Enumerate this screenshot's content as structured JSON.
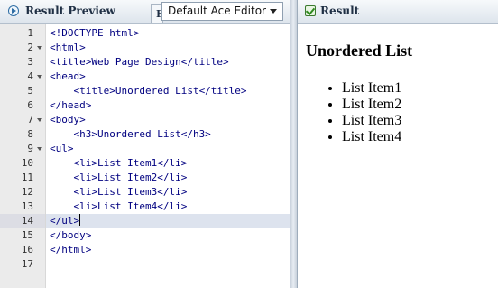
{
  "left_panel": {
    "title": "Result Preview",
    "tab_label": "E",
    "editor_select": {
      "selected": "Default Ace Editor"
    }
  },
  "editor": {
    "active_line": 14,
    "lines": [
      {
        "num": "1",
        "fold": false,
        "text": "<!DOCTYPE html>"
      },
      {
        "num": "2",
        "fold": true,
        "text": "<html>"
      },
      {
        "num": "3",
        "fold": false,
        "text": "<title>Web Page Design</title>"
      },
      {
        "num": "4",
        "fold": true,
        "text": "<head>"
      },
      {
        "num": "5",
        "fold": false,
        "text": "    <title>Unordered List</title>"
      },
      {
        "num": "6",
        "fold": false,
        "text": "</head>"
      },
      {
        "num": "7",
        "fold": true,
        "text": "<body>"
      },
      {
        "num": "8",
        "fold": false,
        "text": "    <h3>Unordered List</h3>"
      },
      {
        "num": "9",
        "fold": true,
        "text": "<ul>"
      },
      {
        "num": "10",
        "fold": false,
        "text": "    <li>List Item1</li>"
      },
      {
        "num": "11",
        "fold": false,
        "text": "    <li>List Item2</li>"
      },
      {
        "num": "12",
        "fold": false,
        "text": "    <li>List Item3</li>"
      },
      {
        "num": "13",
        "fold": false,
        "text": "    <li>List Item4</li>"
      },
      {
        "num": "14",
        "fold": false,
        "text": "</ul>"
      },
      {
        "num": "15",
        "fold": false,
        "text": "</body>"
      },
      {
        "num": "16",
        "fold": false,
        "text": "</html>"
      },
      {
        "num": "17",
        "fold": false,
        "text": ""
      }
    ]
  },
  "right_panel": {
    "title": "Result",
    "heading": "Unordered List",
    "items": [
      "List Item1",
      "List Item2",
      "List Item3",
      "List Item4"
    ]
  },
  "colors": {
    "code_text": "#000080",
    "active_line": "#dde3ee",
    "header_text": "#1f2f44"
  }
}
